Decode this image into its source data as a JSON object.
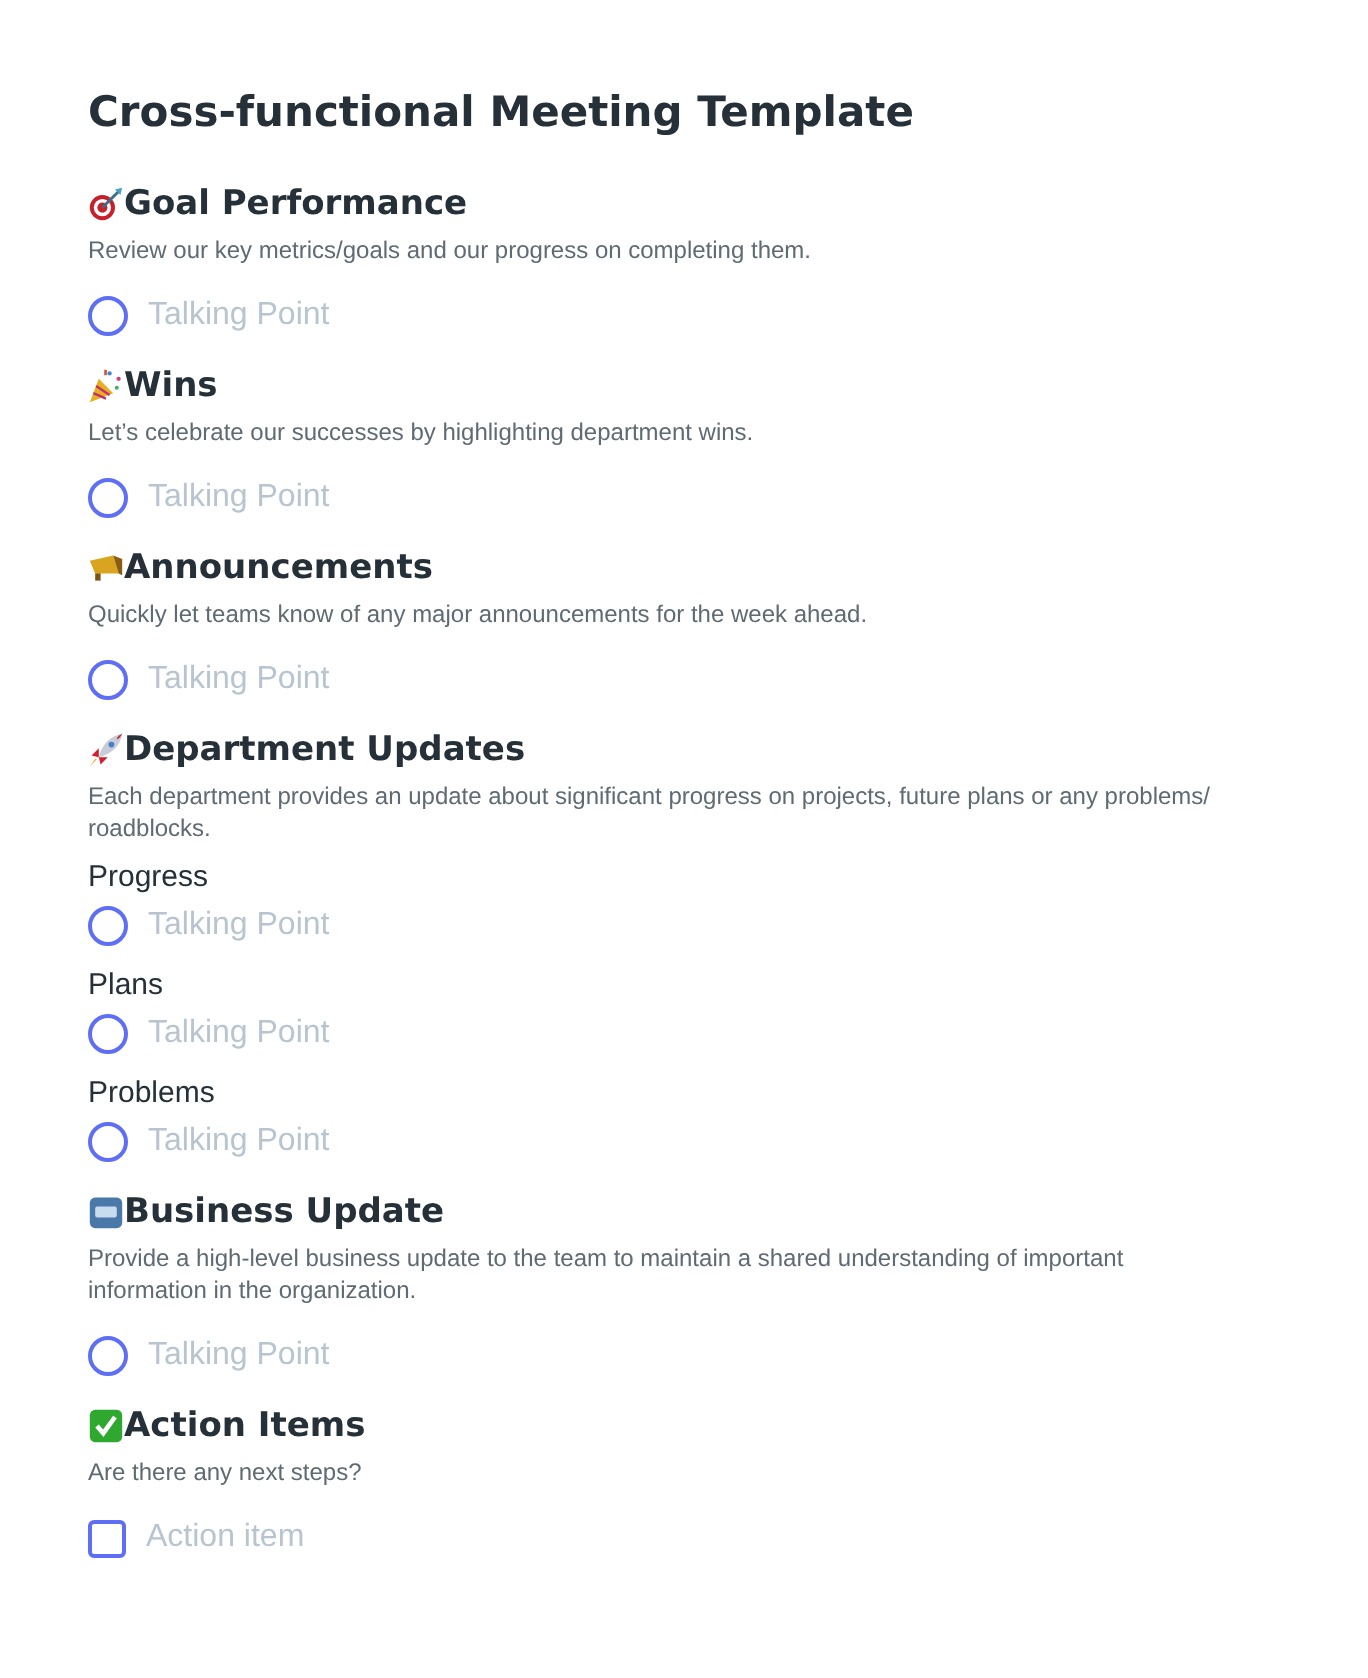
{
  "title": "Cross-functional Meeting Template",
  "sections": [
    {
      "heading": "Goal Performance",
      "description": "Review our key metrics/goals and our progress on completing them.",
      "items": [
        {
          "kind": "talking_point",
          "placeholder": "Talking Point"
        }
      ]
    },
    {
      "heading": "Wins",
      "description": "Let’s celebrate our successes by highlighting department wins.",
      "items": [
        {
          "kind": "talking_point",
          "placeholder": "Talking Point"
        }
      ]
    },
    {
      "heading": "Announcements",
      "description": "Quickly let teams know of any major announcements for the week ahead.",
      "items": [
        {
          "kind": "talking_point",
          "placeholder": "Talking Point"
        }
      ]
    },
    {
      "heading": "Department Updates",
      "description": "Each department provides an update about significant progress on projects, future plans or any problems/ roadblocks.",
      "groups": [
        {
          "label": "Progress",
          "items": [
            {
              "kind": "talking_point",
              "placeholder": "Talking Point"
            }
          ]
        },
        {
          "label": "Plans",
          "items": [
            {
              "kind": "talking_point",
              "placeholder": "Talking Point"
            }
          ]
        },
        {
          "label": "Problems",
          "items": [
            {
              "kind": "talking_point",
              "placeholder": "Talking Point"
            }
          ]
        }
      ]
    },
    {
      "heading": "Business Update",
      "description": "Provide a high-level business update to the team to maintain a shared understanding of important information in the organization.",
      "items": [
        {
          "kind": "talking_point",
          "placeholder": "Talking Point"
        }
      ]
    },
    {
      "heading": "Action Items",
      "description": "Are there any next steps?",
      "items": [
        {
          "kind": "action_item",
          "checked": false,
          "placeholder": "Action item"
        }
      ]
    }
  ]
}
